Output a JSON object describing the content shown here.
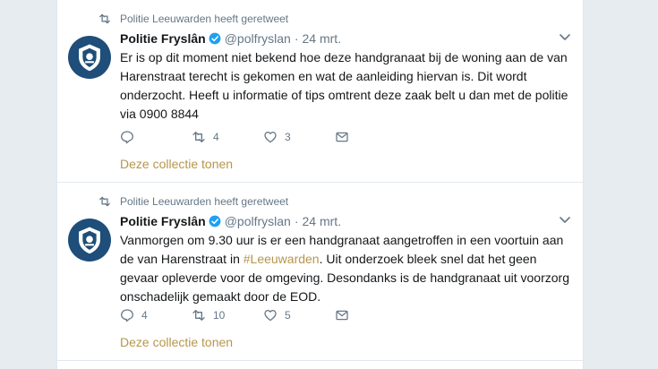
{
  "tweets": [
    {
      "retweeted_by": "Politie Leeuwarden heeft geretweet",
      "name": "Politie Fryslân",
      "handle": "@polfryslan",
      "separator": "·",
      "time": "24 mrt.",
      "text": "Er is op dit moment niet bekend hoe deze handgranaat bij de woning aan de van Harenstraat terecht is gekomen en wat de aanleiding hiervan is. Dit wordt onderzocht. Heeft u informatie of tips omtrent deze zaak belt u dan met de politie via 0900 8844",
      "replies": "",
      "retweets": "4",
      "likes": "3",
      "collection_link": "Deze collectie tonen"
    },
    {
      "retweeted_by": "Politie Leeuwarden heeft geretweet",
      "name": "Politie Fryslân",
      "handle": "@polfryslan",
      "separator": "·",
      "time": "24 mrt.",
      "text_before": "Vanmorgen om 9.30 uur is er een handgranaat aangetroffen in een voortuin aan de van Harenstraat in ",
      "hashtag": "#Leeuwarden",
      "text_after": ". Uit onderzoek bleek snel dat het geen gevaar opleverde voor de omgeving. Desondanks is de handgranaat uit voorzorg onschadelijk gemaakt door de EOD.",
      "replies": "4",
      "retweets": "10",
      "likes": "5",
      "collection_link": "Deze collectie tonen"
    }
  ],
  "icons": {
    "retweet": "retweet-icon",
    "verified": "verified-badge-icon",
    "reply": "reply-icon",
    "like": "heart-icon",
    "message": "envelope-icon",
    "caret": "chevron-down-icon",
    "avatar": "police-logo-icon"
  },
  "colors": {
    "accent": "#b7964d",
    "verified": "#1da1f2",
    "avatar_bg": "#1e4e79",
    "muted": "#657786"
  }
}
